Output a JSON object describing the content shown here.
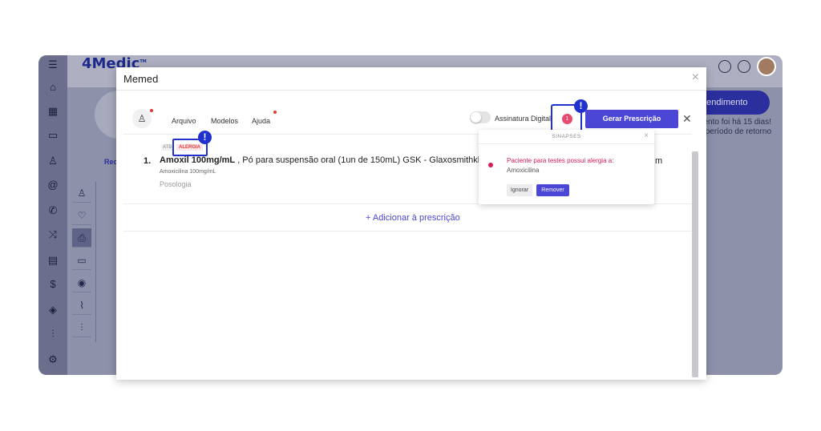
{
  "app": {
    "brand": "4Medic",
    "trademark": "TM"
  },
  "background": {
    "atendimento_button": "atendimento",
    "note_line1": "ento foi há 15 dias!",
    "note_line2": "período de retorno",
    "tab_partial": "Rece"
  },
  "modal": {
    "title": "Memed",
    "toolbar": {
      "menu": [
        "Arquivo",
        "Modelos",
        "Ajuda"
      ],
      "assinatura_label": "Assinatura Digital",
      "alert_count": "1",
      "gerar_button": "Gerar Prescrição"
    },
    "item": {
      "index": "1.",
      "tag_atb": "ATB",
      "tag_alergia": "ALERGIA",
      "name_bold": "Amoxil 100mg/mL",
      "name_rest": " , Pó para suspensão oral (1un de 150mL) GSK - Glaxosmithkline",
      "name_tail": "m",
      "active_ingredient": "Amoxicilina 100mg/mL",
      "posologia_placeholder": "Posologia"
    },
    "add_prescription": "+ Adicionar à prescrição"
  },
  "popover": {
    "title": "SINAPSES",
    "message": "Paciente para testes possui alergia a:",
    "drug": "Amoxicilina",
    "ignore_button": "Ignorar",
    "remove_button": "Remover"
  },
  "annotation": {
    "exclamation": "!"
  },
  "colors": {
    "accent": "#4c46d6",
    "alert": "#d61a55",
    "highlight": "#2031ce"
  }
}
